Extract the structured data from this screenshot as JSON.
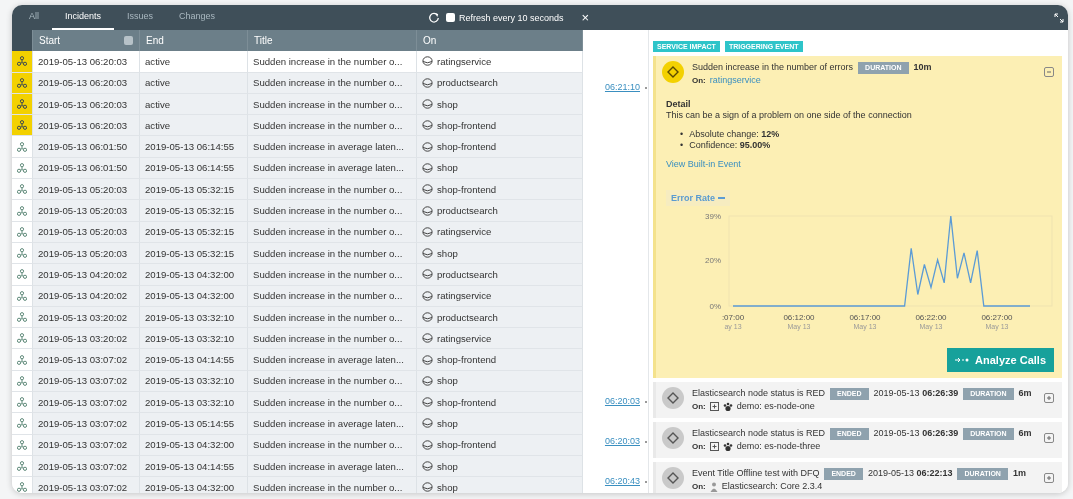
{
  "tabs": [
    {
      "label": "All",
      "selected": false
    },
    {
      "label": "Incidents",
      "selected": true
    },
    {
      "label": "Issues",
      "selected": false
    },
    {
      "label": "Changes",
      "selected": false
    }
  ],
  "refresh": {
    "label": "Refresh every 10 seconds",
    "checked": false
  },
  "close": "×",
  "table": {
    "columns": [
      "Start",
      "End",
      "Title",
      "On"
    ],
    "rows": [
      {
        "active": true,
        "selected": true,
        "start": "2019-05-13 06:20:03",
        "end": "active",
        "title": "Sudden increase in the number o...",
        "on": "ratingservice"
      },
      {
        "active": true,
        "selected": false,
        "start": "2019-05-13 06:20:03",
        "end": "active",
        "title": "Sudden increase in the number o...",
        "on": "productsearch"
      },
      {
        "active": true,
        "selected": false,
        "start": "2019-05-13 06:20:03",
        "end": "active",
        "title": "Sudden increase in the number o...",
        "on": "shop"
      },
      {
        "active": true,
        "selected": false,
        "start": "2019-05-13 06:20:03",
        "end": "active",
        "title": "Sudden increase in the number o...",
        "on": "shop-frontend"
      },
      {
        "active": false,
        "selected": false,
        "start": "2019-05-13 06:01:50",
        "end": "2019-05-13 06:14:55",
        "title": "Sudden increase in average laten...",
        "on": "shop-frontend"
      },
      {
        "active": false,
        "selected": false,
        "start": "2019-05-13 06:01:50",
        "end": "2019-05-13 06:14:55",
        "title": "Sudden increase in average laten...",
        "on": "shop"
      },
      {
        "active": false,
        "selected": false,
        "start": "2019-05-13 05:20:03",
        "end": "2019-05-13 05:32:15",
        "title": "Sudden increase in the number o...",
        "on": "shop-frontend"
      },
      {
        "active": false,
        "selected": false,
        "start": "2019-05-13 05:20:03",
        "end": "2019-05-13 05:32:15",
        "title": "Sudden increase in the number o...",
        "on": "productsearch"
      },
      {
        "active": false,
        "selected": false,
        "start": "2019-05-13 05:20:03",
        "end": "2019-05-13 05:32:15",
        "title": "Sudden increase in the number o...",
        "on": "ratingservice"
      },
      {
        "active": false,
        "selected": false,
        "start": "2019-05-13 05:20:03",
        "end": "2019-05-13 05:32:15",
        "title": "Sudden increase in the number o...",
        "on": "shop"
      },
      {
        "active": false,
        "selected": false,
        "start": "2019-05-13 04:20:02",
        "end": "2019-05-13 04:32:00",
        "title": "Sudden increase in the number o...",
        "on": "productsearch"
      },
      {
        "active": false,
        "selected": false,
        "start": "2019-05-13 04:20:02",
        "end": "2019-05-13 04:32:00",
        "title": "Sudden increase in the number o...",
        "on": "ratingservice"
      },
      {
        "active": false,
        "selected": false,
        "start": "2019-05-13 03:20:02",
        "end": "2019-05-13 03:32:10",
        "title": "Sudden increase in the number o...",
        "on": "productsearch"
      },
      {
        "active": false,
        "selected": false,
        "start": "2019-05-13 03:20:02",
        "end": "2019-05-13 03:32:10",
        "title": "Sudden increase in the number o...",
        "on": "ratingservice"
      },
      {
        "active": false,
        "selected": false,
        "start": "2019-05-13 03:07:02",
        "end": "2019-05-13 04:14:55",
        "title": "Sudden increase in average laten...",
        "on": "shop-frontend"
      },
      {
        "active": false,
        "selected": false,
        "start": "2019-05-13 03:07:02",
        "end": "2019-05-13 03:32:10",
        "title": "Sudden increase in the number o...",
        "on": "shop"
      },
      {
        "active": false,
        "selected": false,
        "start": "2019-05-13 03:07:02",
        "end": "2019-05-13 03:32:10",
        "title": "Sudden increase in the number o...",
        "on": "shop-frontend"
      },
      {
        "active": false,
        "selected": false,
        "start": "2019-05-13 03:07:02",
        "end": "2019-05-13 05:14:55",
        "title": "Sudden increase in average laten...",
        "on": "shop"
      },
      {
        "active": false,
        "selected": false,
        "start": "2019-05-13 03:07:02",
        "end": "2019-05-13 04:32:00",
        "title": "Sudden increase in the number o...",
        "on": "shop-frontend"
      },
      {
        "active": false,
        "selected": false,
        "start": "2019-05-13 03:07:02",
        "end": "2019-05-13 04:14:55",
        "title": "Sudden increase in average laten...",
        "on": "shop"
      },
      {
        "active": false,
        "selected": false,
        "start": "2019-05-13 03:07:02",
        "end": "2019-05-13 04:32:00",
        "title": "Sudden increase in the number o...",
        "on": "shop"
      }
    ]
  },
  "timeline": [
    {
      "kind": "impact",
      "time": "06:21:10",
      "tags": [
        "SERVICE IMPACT",
        "TRIGGERING EVENT"
      ],
      "title": "Sudden increase in the number of errors",
      "duration_label": "DURATION",
      "duration": "10m",
      "on_label": "On:",
      "on": "ratingservice",
      "expanded": true,
      "detail": {
        "heading": "Detail",
        "text": "This can be a sign of a problem on one side of the connection",
        "bullet_marker": "•",
        "bullets": [
          "Absolute change: **12%**",
          "Confidence: **95.00%**"
        ],
        "link": "View Built-in Event"
      },
      "chart_data": {
        "type": "line",
        "categories": [
          ":07:00\nay 13",
          null,
          null,
          null,
          null,
          null,
          null,
          null,
          null,
          null,
          "06:12:00\nMay 13",
          null,
          null,
          null,
          null,
          null,
          null,
          null,
          null,
          null,
          "06:17:00\nMay 13",
          null,
          null,
          null,
          null,
          null,
          null,
          null,
          null,
          null,
          "06:22:00\nMay 13",
          null,
          null,
          null,
          null,
          null,
          null,
          null,
          null,
          null,
          "06:27:00\nMay 13",
          null,
          null,
          null,
          null,
          null
        ],
        "series": [
          {
            "name": "Error Rate",
            "color": "#5b9bd5",
            "values": [
              0,
              0,
              0,
              0,
              0,
              0,
              0,
              0,
              0,
              0,
              0,
              0,
              0,
              0,
              0,
              0,
              0,
              0,
              0,
              0,
              0,
              0,
              0,
              0,
              0,
              0,
              0,
              25,
              5,
              18,
              8,
              20,
              10,
              39,
              12,
              23,
              10,
              24,
              0,
              0,
              0,
              0,
              0,
              0,
              0,
              0
            ]
          }
        ],
        "ylim": [
          0,
          39
        ],
        "yticks": [
          {
            "value": 0,
            "label": "0%"
          },
          {
            "value": 20,
            "label": "20%"
          },
          {
            "value": 39,
            "label": "39%"
          }
        ]
      },
      "action": "Analyze Calls"
    },
    {
      "kind": "event",
      "time": "06:20:03",
      "title": "Elasticsearch node status is RED",
      "ended_label": "ENDED",
      "ended": "2019-05-13 **06:26:39**",
      "duration_label": "DURATION",
      "duration": "6m",
      "on_label": "On:",
      "on": {
        "kind": "node",
        "text": "demo: es-node-one"
      },
      "expanded": false
    },
    {
      "kind": "event",
      "time": "06:20:03",
      "title": "Elasticsearch node status is RED",
      "ended_label": "ENDED",
      "ended": "2019-05-13 **06:26:39**",
      "duration_label": "DURATION",
      "duration": "6m",
      "on_label": "On:",
      "on": {
        "kind": "node",
        "text": "demo: es-node-three"
      },
      "expanded": false
    },
    {
      "kind": "event",
      "time": "06:20:43",
      "title": "Event Title Offline test with DFQ",
      "ended_label": "ENDED",
      "ended": "2019-05-13 **06:22:13**",
      "duration_label": "DURATION",
      "duration": "1m",
      "on_label": "On:",
      "on": {
        "kind": "host",
        "text": "Elasticsearch: Core 2.3.4"
      },
      "expanded": false
    }
  ]
}
